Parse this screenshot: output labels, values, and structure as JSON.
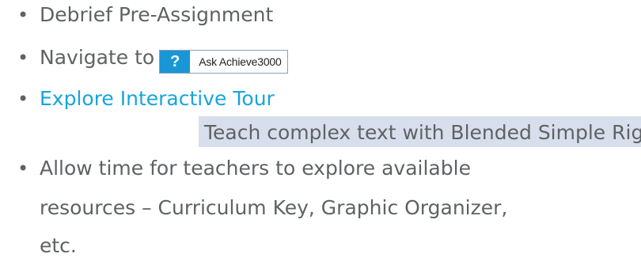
{
  "bullets": {
    "item1": "Debrief Pre-Assignment",
    "item2_prefix": "Navigate to",
    "ask_button": {
      "icon_text": "?",
      "label": "Ask Achieve3000"
    },
    "item3": "Explore Interactive Tour",
    "item3_sub": "Teach complex text with Blended Simple Rigor",
    "item4": {
      "line1": "Allow time for teachers to explore available",
      "line2": "resources – Curriculum Key, Graphic Organizer,",
      "line3": "etc."
    },
    "bullet_char": "•"
  },
  "colors": {
    "text": "#5f6265",
    "link": "#16a5dd",
    "highlight": "#d8dfec",
    "button_blue": "#1996d6"
  }
}
